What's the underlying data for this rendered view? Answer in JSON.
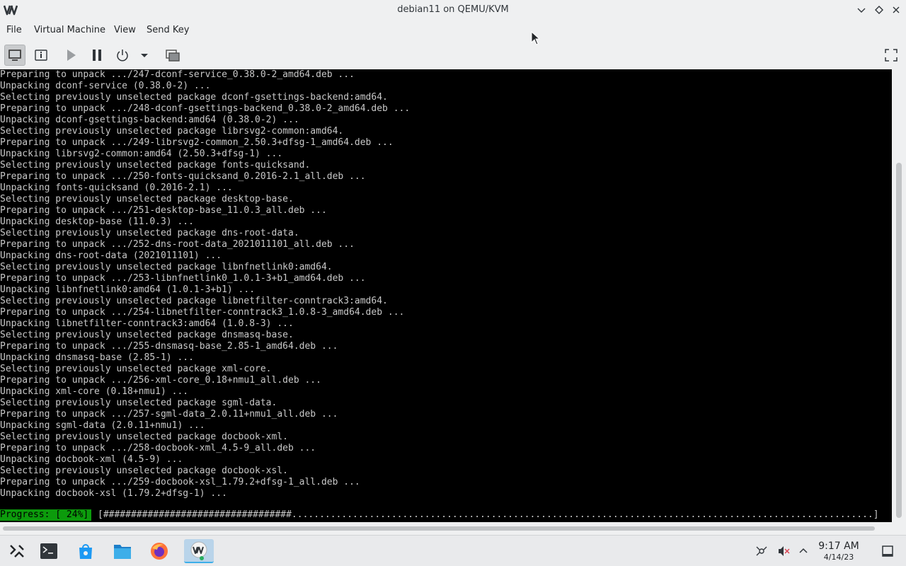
{
  "window": {
    "title": "debian11 on QEMU/KVM",
    "logo_icon": "virt-manager-logo"
  },
  "menubar": {
    "items": [
      "File",
      "Virtual Machine",
      "View",
      "Send Key"
    ]
  },
  "toolbar": {
    "buttons": [
      "console-view-icon",
      "details-icon",
      "run-icon",
      "pause-icon",
      "shutdown-icon",
      "shutdown-menu-icon",
      "snapshots-icon",
      "fullscreen-icon"
    ]
  },
  "console": {
    "lines": [
      "Preparing to unpack .../247-dconf-service_0.38.0-2_amd64.deb ...",
      "Unpacking dconf-service (0.38.0-2) ...",
      "Selecting previously unselected package dconf-gsettings-backend:amd64.",
      "Preparing to unpack .../248-dconf-gsettings-backend_0.38.0-2_amd64.deb ...",
      "Unpacking dconf-gsettings-backend:amd64 (0.38.0-2) ...",
      "Selecting previously unselected package librsvg2-common:amd64.",
      "Preparing to unpack .../249-librsvg2-common_2.50.3+dfsg-1_amd64.deb ...",
      "Unpacking librsvg2-common:amd64 (2.50.3+dfsg-1) ...",
      "Selecting previously unselected package fonts-quicksand.",
      "Preparing to unpack .../250-fonts-quicksand_0.2016-2.1_all.deb ...",
      "Unpacking fonts-quicksand (0.2016-2.1) ...",
      "Selecting previously unselected package desktop-base.",
      "Preparing to unpack .../251-desktop-base_11.0.3_all.deb ...",
      "Unpacking desktop-base (11.0.3) ...",
      "Selecting previously unselected package dns-root-data.",
      "Preparing to unpack .../252-dns-root-data_2021011101_all.deb ...",
      "Unpacking dns-root-data (2021011101) ...",
      "Selecting previously unselected package libnfnetlink0:amd64.",
      "Preparing to unpack .../253-libnfnetlink0_1.0.1-3+b1_amd64.deb ...",
      "Unpacking libnfnetlink0:amd64 (1.0.1-3+b1) ...",
      "Selecting previously unselected package libnetfilter-conntrack3:amd64.",
      "Preparing to unpack .../254-libnetfilter-conntrack3_1.0.8-3_amd64.deb ...",
      "Unpacking libnetfilter-conntrack3:amd64 (1.0.8-3) ...",
      "Selecting previously unselected package dnsmasq-base.",
      "Preparing to unpack .../255-dnsmasq-base_2.85-1_amd64.deb ...",
      "Unpacking dnsmasq-base (2.85-1) ...",
      "Selecting previously unselected package xml-core.",
      "Preparing to unpack .../256-xml-core_0.18+nmu1_all.deb ...",
      "Unpacking xml-core (0.18+nmu1) ...",
      "Selecting previously unselected package sgml-data.",
      "Preparing to unpack .../257-sgml-data_2.0.11+nmu1_all.deb ...",
      "Unpacking sgml-data (2.0.11+nmu1) ...",
      "Selecting previously unselected package docbook-xml.",
      "Preparing to unpack .../258-docbook-xml_4.5-9_all.deb ...",
      "Unpacking docbook-xml (4.5-9) ...",
      "Selecting previously unselected package docbook-xsl.",
      "Preparing to unpack .../259-docbook-xsl_1.79.2+dfsg-1_all.deb ...",
      "Unpacking docbook-xsl (1.79.2+dfsg-1) ..."
    ],
    "progress_label": "Progress: [ 24%]",
    "progress_bar": "[##################################.........................................................................................................]",
    "progress_percent": 24,
    "progress_color": "#0c9b0c"
  },
  "taskbar": {
    "apps": [
      "app-launcher-icon",
      "terminal-icon",
      "discover-store-icon",
      "file-manager-icon",
      "firefox-icon",
      "virt-manager-icon"
    ],
    "active_app": "virt-manager-icon",
    "tray": [
      "network-icon",
      "volume-muted-icon",
      "tray-expand-icon",
      "show-desktop-icon"
    ],
    "time": "9:17 AM",
    "date": "4/14/23"
  },
  "colors": {
    "accent": "#3daee9",
    "chrome_bg": "#eff0f1",
    "console_bg": "#000000",
    "console_fg": "#c8c8c8"
  }
}
